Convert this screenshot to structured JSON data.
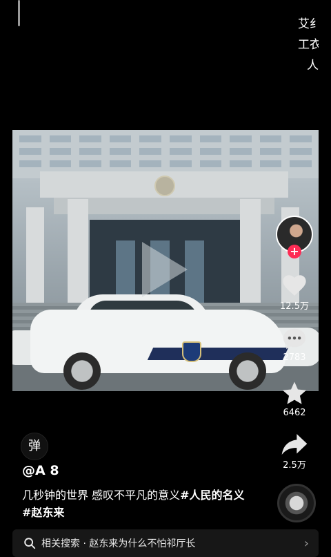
{
  "top_right": {
    "lines": [
      "艾纟",
      "工衣",
      "人"
    ]
  },
  "video": {
    "description_label": ""
  },
  "rail": {
    "like_count": "12.5万",
    "comment_count": "2783",
    "favorite_count": "6462",
    "share_count": "2.5万"
  },
  "post": {
    "danmu_label": "弹",
    "author": "@A  8",
    "caption_text": "几秒钟的世界 感叹不平凡的意义",
    "tag_1": "#人民的名义",
    "tag_2": "#赵东来"
  },
  "search": {
    "label": "相关搜索 · 赵东来为什么不怕祁厅长"
  },
  "colors": {
    "accent": "#fe2c55",
    "background": "#000000"
  }
}
